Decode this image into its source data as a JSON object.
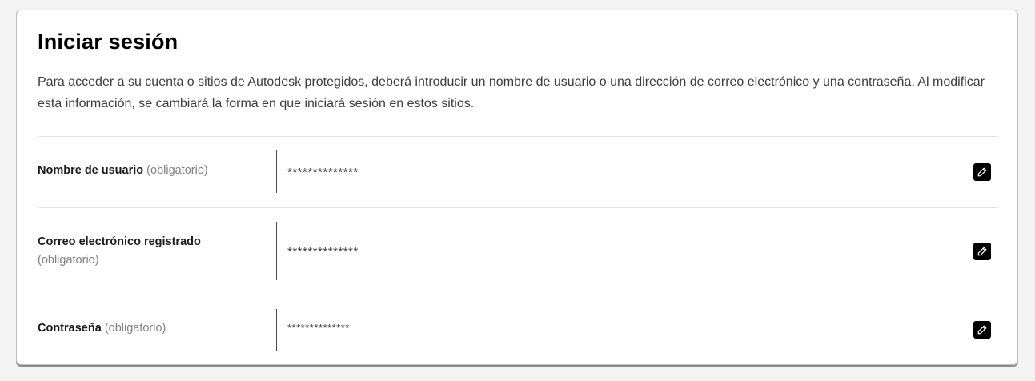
{
  "section": {
    "title": "Iniciar sesión",
    "description": "Para acceder a su cuenta o sitios de Autodesk protegidos, deberá introducir un nombre de usuario o una dirección de correo electrónico y una contraseña. Al modificar esta información, se cambiará la forma en que iniciará sesión en estos sitios."
  },
  "fields": [
    {
      "label": "Nombre de usuario",
      "required": "(obligatorio)",
      "value": "**************",
      "edit_icon": "pencil-icon"
    },
    {
      "label": "Correo electrónico registrado",
      "required": "(obligatorio)",
      "value": "**************",
      "edit_icon": "pencil-icon"
    },
    {
      "label": "Contraseña",
      "required": "(obligatorio)",
      "value": "**************",
      "edit_icon": "pencil-icon"
    }
  ]
}
